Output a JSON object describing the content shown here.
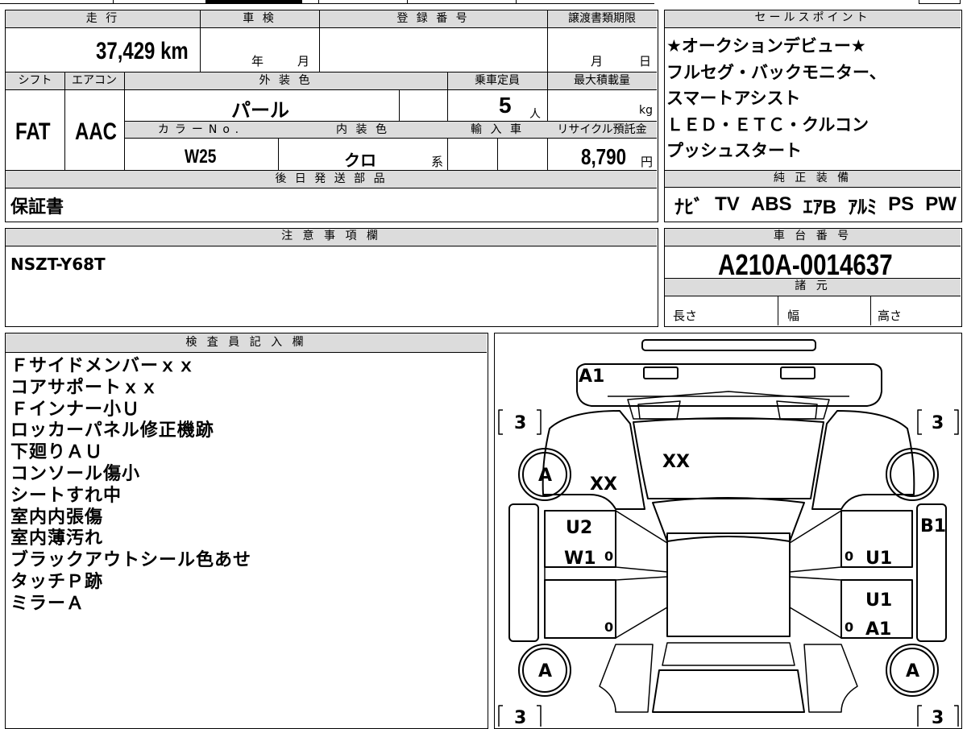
{
  "vehicle_info": {
    "mileage_label": "走 行",
    "mileage": "37,429 km",
    "shaken_label": "車 検",
    "shaken_year_unit": "年",
    "shaken_month_unit": "月",
    "registration_label": "登 録 番 号",
    "transfer_label": "譲渡書類期限",
    "transfer_month_unit": "月",
    "transfer_day_unit": "日",
    "shift_label": "シフト",
    "shift": "FAT",
    "aircon_label": "エアコン",
    "aircon": "AAC",
    "exterior_color_label": "外 装 色",
    "exterior_color": "パール",
    "capacity_label": "乗車定員",
    "capacity": "5",
    "capacity_unit": "人",
    "max_load_label": "最大積載量",
    "max_load_unit": "kg",
    "color_no_label": "カラーNo.",
    "color_no": "W25",
    "interior_color_label": "内 装 色",
    "interior_color": "クロ",
    "interior_suffix": "系",
    "import_label": "輸 入 車",
    "recycle_label": "リサイクル預託金",
    "recycle_amount": "8,790",
    "recycle_unit": "円"
  },
  "later_parts": {
    "label": "後 日 発 送 部 品",
    "value": "保証書"
  },
  "sales_points": {
    "label": "セールスポイント",
    "lines": [
      "★オークションデビュー★",
      "フルセグ・バックモニター、",
      "スマートアシスト",
      "ＬＥＤ・ＥＴＣ・クルコン",
      "プッシュスタート"
    ]
  },
  "genuine_equipment": {
    "label": "純 正 装 備",
    "items": [
      "ﾅﾋﾞ",
      "TV",
      "ABS",
      "ｴｱB",
      "ｱﾙﾐ",
      "PS",
      "PW"
    ]
  },
  "notes": {
    "label": "注 意 事 項 欄",
    "value": "NSZT-Y68T"
  },
  "chassis": {
    "label": "車 台 番 号",
    "number": "A210A-0014637",
    "specs_label": "諸 元",
    "length_label": "長さ",
    "width_label": "幅",
    "height_label": "高さ"
  },
  "inspector": {
    "label": "検 査 員 記 入 欄",
    "lines": [
      "Ｆサイドメンバーｘｘ",
      "コアサポートｘｘ",
      "Ｆインナー小Ｕ",
      "ロッカーパネル修正機跡",
      "下廻りＡＵ",
      "コンソール傷小",
      "シートすれ中",
      "室内内張傷",
      "室内薄汚れ",
      "ブラックアウトシール色あせ",
      "タッチＰ跡",
      "ミラーＡ"
    ]
  },
  "diagram": {
    "tire_score": "3",
    "marks": {
      "a1_top": "A1",
      "xx_hood": "XX",
      "xx_left": "XX",
      "a_fl": "A",
      "a_rl": "A",
      "a_rr": "A",
      "u2": "U2",
      "w1": "W1",
      "b1": "B1",
      "u1_fr": "U1",
      "u1_rr": "U1",
      "a1_rr": "A1",
      "zero": "0"
    }
  }
}
